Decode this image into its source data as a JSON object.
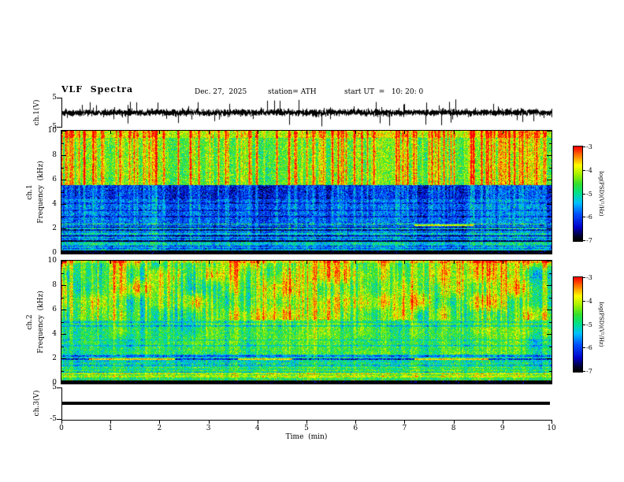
{
  "figure": {
    "background": "#ffffff",
    "header": {
      "title": "VLF  Spectra",
      "date": "Dec. 27,  2025",
      "station": "station= ATH",
      "start_ut": "start UT  =   10: 20: 0"
    },
    "x_axis": {
      "title": "Time  (min)",
      "min": 0,
      "max": 10,
      "ticks": [
        0,
        1,
        2,
        3,
        4,
        5,
        6,
        7,
        8,
        9,
        10
      ]
    },
    "freq_axis": {
      "title": "Frequency  (kHz)",
      "min": 0,
      "max": 10,
      "major_ticks": [
        0,
        2,
        4,
        6,
        8,
        10
      ],
      "minor_ticks": [
        1,
        3,
        5,
        7,
        9
      ]
    },
    "volt_axis": {
      "min": -5,
      "max": 5,
      "ticks": [
        5,
        -5
      ]
    },
    "panel_labels": {
      "ch1_wave": "ch.1(V)",
      "ch1_spec_channel": "ch.1",
      "ch1_spec_freq": "Frequency  (kHz)",
      "ch2_spec_channel": "ch.2",
      "ch2_spec_freq": "Frequency  (kHz)",
      "ch3_wave": "ch.3(V)"
    },
    "colorbar": {
      "title": "log(PSD)(V²/Hz)",
      "ticks": [
        -3,
        -4,
        -5,
        -6,
        -7
      ],
      "min": -7,
      "max": -3,
      "stops": [
        [
          0,
          "#000000"
        ],
        [
          0.05,
          "#000030"
        ],
        [
          0.14,
          "#0000c8"
        ],
        [
          0.28,
          "#0050ff"
        ],
        [
          0.4,
          "#00c0ff"
        ],
        [
          0.5,
          "#00e090"
        ],
        [
          0.6,
          "#30e030"
        ],
        [
          0.7,
          "#a0f000"
        ],
        [
          0.8,
          "#ffff00"
        ],
        [
          0.9,
          "#ff8000"
        ],
        [
          1,
          "#ff0000"
        ]
      ]
    }
  },
  "chart_data": [
    {
      "id": "ch1_wave",
      "type": "line",
      "panel": "ch.1(V)",
      "xlim": [
        0,
        10
      ],
      "x_unit": "min",
      "ylim": [
        -5,
        5
      ],
      "y_unit": "V",
      "yticks": [
        5,
        -5
      ],
      "description": "Dense broadband noise band of roughly ±1.5 V about 0 V with frequent impulsive sferic spikes reaching about ±4.5 V across the whole 10-minute record.",
      "synthesis": {
        "seed": 20251227,
        "noise_sigma": 0.55,
        "samples_per_column": 7,
        "spike_probability": 0.012,
        "spike_min": 1.2,
        "spike_max": 4.3
      }
    },
    {
      "id": "ch1_spec",
      "type": "heatmap",
      "panel": "ch.1",
      "xlim": [
        0,
        10
      ],
      "x_unit": "min",
      "ylim": [
        0,
        10
      ],
      "y_unit": "kHz",
      "zlim": [
        -7,
        -3
      ],
      "zlabel": "log(PSD)(V²/Hz)",
      "description": "Spectrogram: yellow-green PSD (~-4.6) above 5.6 kHz with dense vertical sferic streaks reaching red near 10 kHz; dark-blue quiet band 4.4-5.6 kHz (~-6.2); blue 2.5-4.4 kHz (~-5.9); banded cyan/blue region below 2.5 kHz with several dark horizontal lines; black below ~0.3 kHz; short orange segment near 2.3 kHz around 7.2-8.4 min.",
      "synthesis": {
        "seed": 101,
        "noise_sigma": 0.36,
        "bands": [
          {
            "f0": 9.4,
            "f1": 10.01,
            "level": -4.15
          },
          {
            "f0": 5.6,
            "f1": 9.4,
            "level": -4.6
          },
          {
            "f0": 4.4,
            "f1": 5.6,
            "level": -6.25
          },
          {
            "f0": 2.45,
            "f1": 4.4,
            "level": -5.9
          },
          {
            "f0": 0.28,
            "f1": 2.45,
            "level": -5.45,
            "row_banding": 0.55
          },
          {
            "f0": -0.01,
            "f1": 0.28,
            "level": -7.3
          }
        ],
        "dark_lines": [
          {
            "f": 0.6,
            "d": -1.0
          },
          {
            "f": 1.0,
            "d": -1.1
          },
          {
            "f": 1.45,
            "d": -0.9
          },
          {
            "f": 1.9,
            "d": -1.1
          },
          {
            "f": 2.15,
            "d": -0.8
          },
          {
            "f": 3.0,
            "d": -0.6
          },
          {
            "f": 3.5,
            "d": -0.5
          },
          {
            "f": 4.1,
            "d": -0.5
          }
        ],
        "hot_line": {
          "f": 2.3,
          "half_width": 0.05,
          "base": -5.9,
          "segments": [
            [
              7.2,
              8.4
            ]
          ],
          "segment_level": -4.0
        },
        "streaks": {
          "probability": 0.26,
          "min": 0.5,
          "max": 1.9,
          "full_above_khz": 5.6,
          "low_factor": 0.35
        }
      }
    },
    {
      "id": "ch2_spec",
      "type": "heatmap",
      "panel": "ch.2",
      "xlim": [
        0,
        10
      ],
      "x_unit": "min",
      "ylim": [
        0,
        10
      ],
      "y_unit": "kHz",
      "zlim": [
        -7,
        -3
      ],
      "zlabel": "log(PSD)(V²/Hz)",
      "description": "Spectrogram: green background (~-4.8) with smooth blue patches and vertical streaks above ~5 kHz, red speckle at the 10 kHz edge; intermittent red-hot line segments near 2 kHz (0.55-2.3, 3.6-4.7, 7.2-8.7 min) over a dark carrier; thin dark lines near 2.25, 3.1, 4.7 and 5.0 kHz; bright green/yellow banding below 1 kHz; black below ~0.3 kHz.",
      "synthesis": {
        "seed": 202,
        "noise_sigma": 0.33,
        "bands": [
          {
            "f0": 5.2,
            "f1": 10.01,
            "level": -4.75,
            "patch_amp": 0.75
          },
          {
            "f0": 2.4,
            "f1": 5.2,
            "level": -4.85,
            "patch_amp": 0.35
          },
          {
            "f0": 1.05,
            "f1": 2.4,
            "level": -5.2,
            "row_banding": 0.4
          },
          {
            "f0": 0.28,
            "f1": 1.05,
            "level": -4.5,
            "row_banding": 0.5
          },
          {
            "f0": -0.01,
            "f1": 0.28,
            "level": -7.3
          }
        ],
        "top_edge": {
          "f0": 9.82,
          "boost": 0.9
        },
        "dark_lines": [
          {
            "f": 0.9,
            "d": -0.5
          },
          {
            "f": 1.45,
            "d": -0.5
          },
          {
            "f": 2.25,
            "d": -0.9
          },
          {
            "f": 3.1,
            "d": -0.6
          },
          {
            "f": 3.55,
            "d": -0.4
          },
          {
            "f": 4.7,
            "d": -0.8
          },
          {
            "f": 5.0,
            "d": -0.6
          }
        ],
        "hot_line": {
          "f": 2.0,
          "half_width": 0.07,
          "base": -6.2,
          "segments": [
            [
              0.55,
              2.3
            ],
            [
              3.6,
              4.7
            ],
            [
              7.2,
              8.7
            ]
          ],
          "segment_level": -3.8
        },
        "streaks": {
          "probability": 0.3,
          "min": 0.4,
          "max": 1.4,
          "full_above_khz": 5.2,
          "low_factor": 0.45
        }
      }
    },
    {
      "id": "ch3_wave",
      "type": "line",
      "panel": "ch.3(V)",
      "xlim": [
        0,
        10
      ],
      "x_unit": "min",
      "ylim": [
        -5,
        5
      ],
      "y_unit": "V",
      "yticks": [
        5,
        -5
      ],
      "series": [
        {
          "name": "ch.3(V)",
          "value": 0,
          "note": "flat thick trace at 0 V for the entire record (channel inactive)"
        }
      ]
    }
  ]
}
